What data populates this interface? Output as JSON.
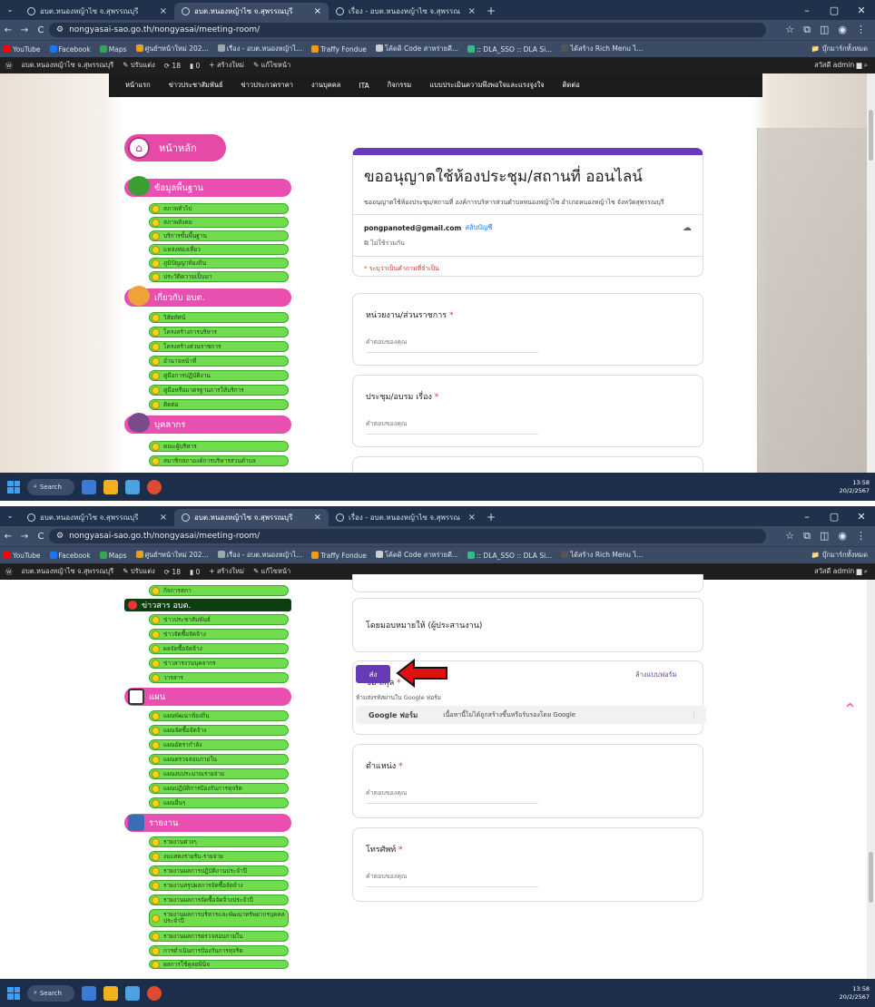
{
  "browser": {
    "tabs": [
      {
        "title": "อบต.หนองหญ้าไซ จ.สุพรรณบุรี",
        "active": false
      },
      {
        "title": "อบต.หนองหญ้าไซ จ.สุพรรณบุรี",
        "active": true
      },
      {
        "title": "เรื่อง - อบต.หนองหญ้าไซ จ.สุพรรณ",
        "active": false
      }
    ],
    "url": "nongyasai-sao.go.th/nongyasai/meeting-room/",
    "bookmarks": [
      "YouTube",
      "Facebook",
      "Maps",
      "ศูนย์ฯหน้าใหม่ 202...",
      "เรื่อง - อบต.หนองหญ้าไ...",
      "Traffy Fondue",
      "โค้ดดิ Code สาหร่ายดี...",
      ":: DLA_SSO :: DLA Si...",
      "ได้สร้าง Rich Menu ไ..."
    ],
    "all_bookmarks": "บุ๊กมาร์กทั้งหมด"
  },
  "adminbar": {
    "site": "อบต.หนองหญ้าไซ จ.สุพรรณบุรี",
    "customize": "ปรับแต่ง",
    "updates": "18",
    "comments": "0",
    "new": "สร้างใหม่",
    "edit": "แก้ไขหน้า",
    "greeting": "สวัสดี admin"
  },
  "topnav": [
    "หน้าแรก",
    "ข่าวประชาสัมพันธ์",
    "ข่าวประกวดราคา",
    "งานบุคคล",
    "ITA",
    "กิจกรรม",
    "แบบประเมินความพึงพอใจและแรงจูงใจ",
    "ติดต่อ"
  ],
  "sidebar1": {
    "home": "หน้าหลัก",
    "basic_title": "ข้อมูลพื้นฐาน",
    "basic_items": [
      "สภาพทั่วไป",
      "สภาพสังคม",
      "บริการขั้นพื้นฐาน",
      "แหล่งท่องเที่ยว",
      "ภูมิปัญญาท้องถิ่น",
      "ประวัติความเป็นมา"
    ],
    "about_title": "เกี่ยวกับ อบต.",
    "about_items": [
      "วิสัยทัศน์",
      "โครงสร้างการบริหาร",
      "โครงสร้างส่วนราชการ",
      "อำนาจหน้าที่",
      "คู่มือการปฏิบัติงาน",
      "คู่มือหรือมาตรฐานการให้บริการ",
      "ติดต่อ"
    ],
    "staff_title": "บุคลากร",
    "staff_items": [
      "คณะผู้บริหาร",
      "สมาชิกสภาองค์การบริหารส่วนตำบล"
    ]
  },
  "sidebar2": {
    "top_item": "กิจการสภา",
    "news_title": "ข่าวสาร อบต.",
    "news_items": [
      "ข่าวประชาสัมพันธ์",
      "ข่าวจัดซื้อจัดจ้าง",
      "ผลจัดซื้อจัดจ้าง",
      "ข่าวสารงานบุคลากร",
      "วารสาร"
    ],
    "plan_title": "แผน",
    "plan_items": [
      "แผนพัฒนาท้องถิ่น",
      "แผนจัดซื้อจัดจ้าง",
      "แผนอัตรากำลัง",
      "แผนตรวจสอบภายใน",
      "แผนงบประมาณรายจ่าย",
      "แผนปฏิบัติการป้องกันการทุจริต",
      "แผนอื่นๆ"
    ],
    "report_title": "รายงาน",
    "report_items": [
      "รายงานต่างๆ",
      "งบแสดงรายรับ-รายจ่าย",
      "รายงานผลการปฏิบัติงานประจำปี",
      "รายงานสรุปผลการจัดซื้อจัดจ้าง",
      "รายงานผลการจัดซื้อจัดจ้างประจำปี",
      "รายงานผลการบริหารและพัฒนาทรัพยากรบุคคลประจำปี",
      "รายงานผลการตรวจสอบภายใน",
      "การดำเนินการป้องกันการทุจริต",
      "ผลการใช้ดุลยพินิจ"
    ]
  },
  "form": {
    "title": "ขออนุญาตใช้ห้องประชุม/สถานที่ ออนไลน์",
    "description": "ขออนุญาตใช้ห้องประชุม/สถานที่ องค์การบริหารส่วนตำบลหนองหญ้าไซ อำเภอหนองหญ้าไซ จังหวัดสุพรรณบุรี",
    "email": "pongpanoted@gmail.com",
    "switch_account": "สลับบัญชี",
    "not_shared": "ไม่ใช้ร่วมกัน",
    "required_note": "* ระบุว่าเป็นคำถามที่จำเป็น",
    "answer_placeholder": "คำตอบของคุณ",
    "q_agency": "หน่วยงาน/ส่วนราชการ",
    "q_meeting": "ประชุม/อบรม เรื่อง",
    "q_assigned": "โดยมอบหมายให้ (ผู้ประสานงาน)",
    "q_name": "ชื่อ-สกุล",
    "q_position": "ตำแหน่ง",
    "q_phone": "โทรศัพท์",
    "submit": "ส่ง",
    "clear": "ล้างแบบฟอร์ม",
    "never_submit": "ห้ามส่งรหัสผ่านใน Google ฟอร์ม",
    "google_forms": "Google ฟอร์ม",
    "footer_note": "เนื้อหานี้ไม่ได้ถูกสร้างขึ้นหรือรับรองโดย Google"
  },
  "taskbar": {
    "search": "Search",
    "time1": "13:58",
    "time2": "13:58",
    "date": "20/2/2567"
  },
  "colors": {
    "accent": "#673ab7",
    "category_pink": "#e94fb0",
    "item_green": "#6fdd4d",
    "annotation_arrow": "#e01010"
  }
}
